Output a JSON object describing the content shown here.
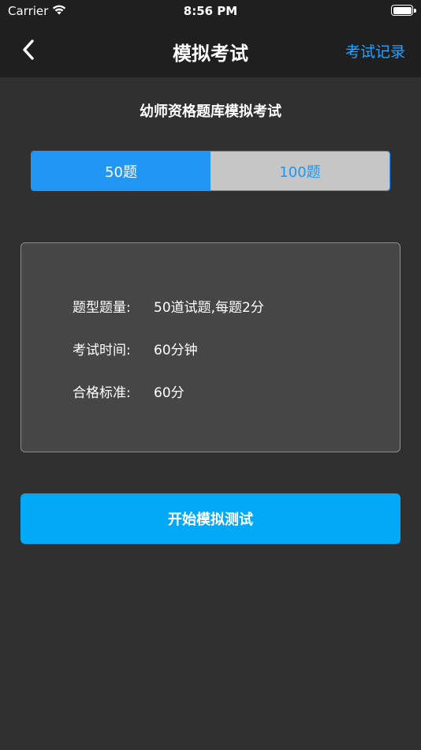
{
  "status_bar": {
    "carrier": "Carrier",
    "time": "8:56 PM",
    "icons": [
      "wifi-icon",
      "battery-icon"
    ]
  },
  "nav": {
    "title": "模拟考试",
    "right_action": "考试记录",
    "back_icon": "chevron-left-icon",
    "accent_color": "#2aa1ff"
  },
  "exam": {
    "subtitle": "幼师资格题库模拟考试",
    "segments": [
      {
        "label": "50题",
        "selected": true
      },
      {
        "label": "100题",
        "selected": false
      }
    ],
    "info": [
      {
        "label": "题型题量:",
        "value": "50道试题,每题2分"
      },
      {
        "label": "考试时间:",
        "value": "60分钟"
      },
      {
        "label": "合格标准:",
        "value": "60分"
      }
    ],
    "start_label": "开始模拟测试"
  },
  "colors": {
    "background": "#303030",
    "bar_background": "#1f1f1f",
    "segment_active": "#2196f3",
    "segment_inactive": "#c6c6c6",
    "card_background": "#464646",
    "start_button": "#03a9f4"
  }
}
